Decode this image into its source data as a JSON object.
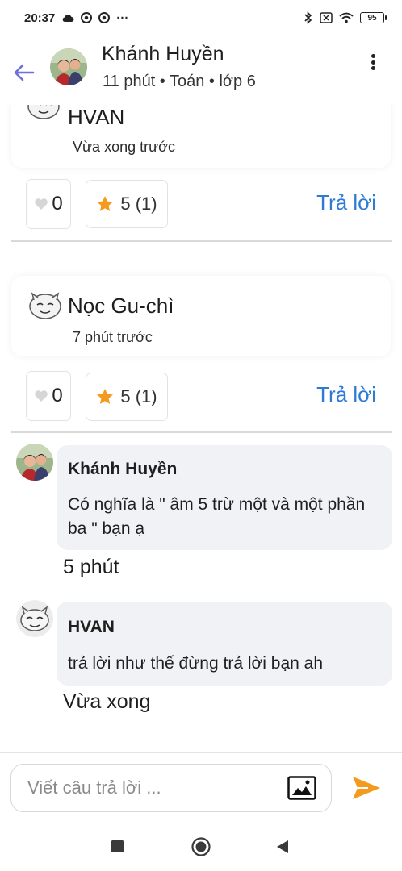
{
  "status_bar": {
    "time": "20:37",
    "more": "···",
    "battery": "95"
  },
  "header": {
    "name": "Khánh Huyền",
    "meta": "11 phút • Toán • lớp 6"
  },
  "answers": [
    {
      "name": "HVAN",
      "time": "Vừa xong trước",
      "likes": "0",
      "rating": "5 (1)",
      "reply_label": "Trả lời"
    },
    {
      "name": "Nọc Gu-chì",
      "time": "7 phút trước",
      "likes": "0",
      "rating": "5 (1)",
      "reply_label": "Trả lời"
    }
  ],
  "comments": [
    {
      "author": "Khánh Huyền",
      "text": "Có nghĩa là \" âm 5 trừ một và một phần ba \" bạn ạ",
      "time": "5 phút"
    },
    {
      "author": "HVAN",
      "text": "trả lời như thế đừng trả lời bạn ah",
      "time": "Vừa xong"
    }
  ],
  "compose": {
    "placeholder": "Viết câu trả lời ..."
  },
  "colors": {
    "accent_blue": "#2f7ad6",
    "send_orange": "#f39a1f",
    "star_orange": "#f39a1f",
    "back_arrow": "#6e6fd8",
    "bubble_bg": "#f1f2f6"
  }
}
